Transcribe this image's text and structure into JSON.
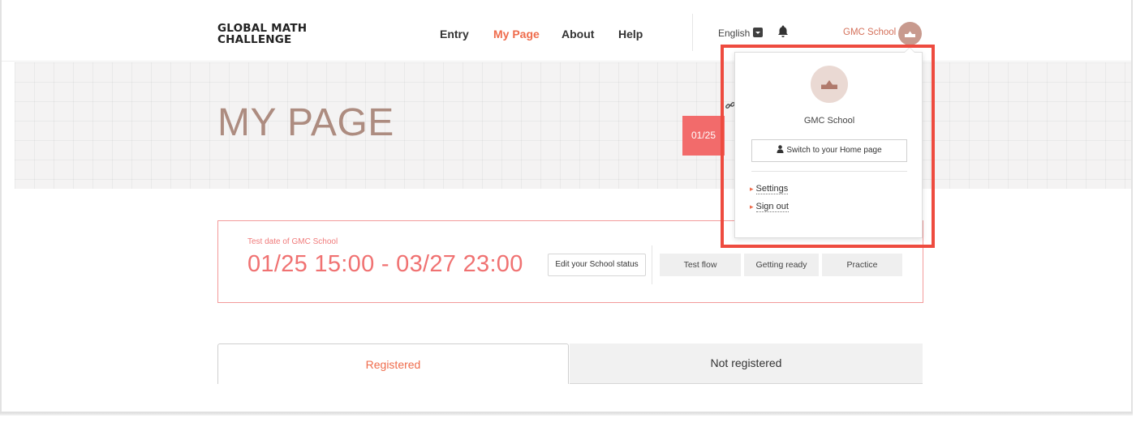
{
  "header": {
    "logo_line1": "GLOBAL MATH",
    "logo_line2": "CHALLENGE",
    "nav": [
      {
        "label": "Entry",
        "active": false
      },
      {
        "label": "My Page",
        "active": true
      },
      {
        "label": "About",
        "active": false
      },
      {
        "label": "Help",
        "active": false
      }
    ],
    "language": "English",
    "user_name": "GMC School"
  },
  "hero": {
    "title": "MY PAGE",
    "date_tag": "01/25"
  },
  "test": {
    "label": "Test date of GMC School",
    "date_range": "01/25 15:00 - 03/27 23:00",
    "edit_button": "Edit your School status",
    "buttons": [
      "Test flow",
      "Getting ready",
      "Practice"
    ]
  },
  "tabs": {
    "registered": "Registered",
    "not_registered": "Not registered"
  },
  "dropdown": {
    "name": "GMC School",
    "switch_button": "Switch to your Home page",
    "links": [
      "Settings",
      "Sign out"
    ]
  },
  "colors": {
    "accent": "#ef6c4c",
    "date_red": "#f07272",
    "title_brown": "#ad8c80",
    "highlight": "#ee4b3f"
  },
  "icons": [
    "bell-icon",
    "language-dropdown-icon",
    "school-icon",
    "link-icon",
    "user-icon"
  ]
}
